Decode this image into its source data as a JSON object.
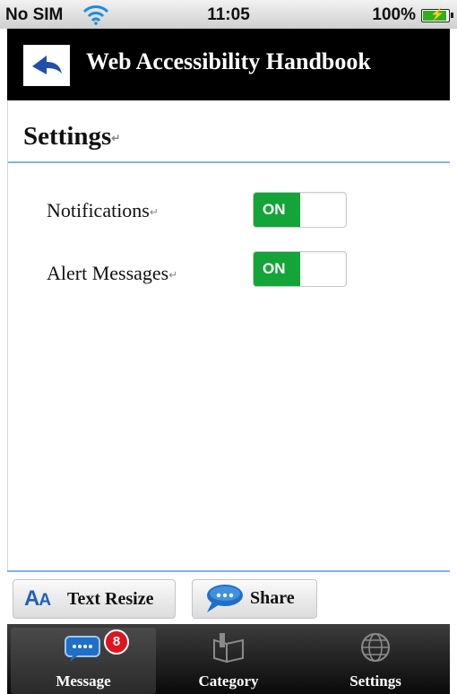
{
  "status_bar": {
    "carrier": "No SIM",
    "time": "11:05",
    "battery": "100%",
    "battery_level": 1.0
  },
  "header": {
    "title": "Web Accessibility Handbook"
  },
  "settings": {
    "title": "Settings",
    "rows": [
      {
        "label": "Notifications",
        "toggle_text": "ON"
      },
      {
        "label": "Alert Messages",
        "toggle_text": "ON"
      }
    ]
  },
  "actions": {
    "text_resize_icon": "Aa",
    "text_resize_label": "Text Resize",
    "share_label": "Share"
  },
  "tabbar": {
    "tabs": [
      {
        "label": "Message",
        "badge": "8",
        "icon": "message-icon"
      },
      {
        "label": "Category",
        "icon": "category-icon"
      },
      {
        "label": "Settings",
        "icon": "globe-icon"
      }
    ]
  },
  "colors": {
    "toggle_on": "#13a538",
    "divider": "#7fb6e6",
    "accent_blue": "#1f5fbf",
    "badge_red": "#e0141e"
  }
}
